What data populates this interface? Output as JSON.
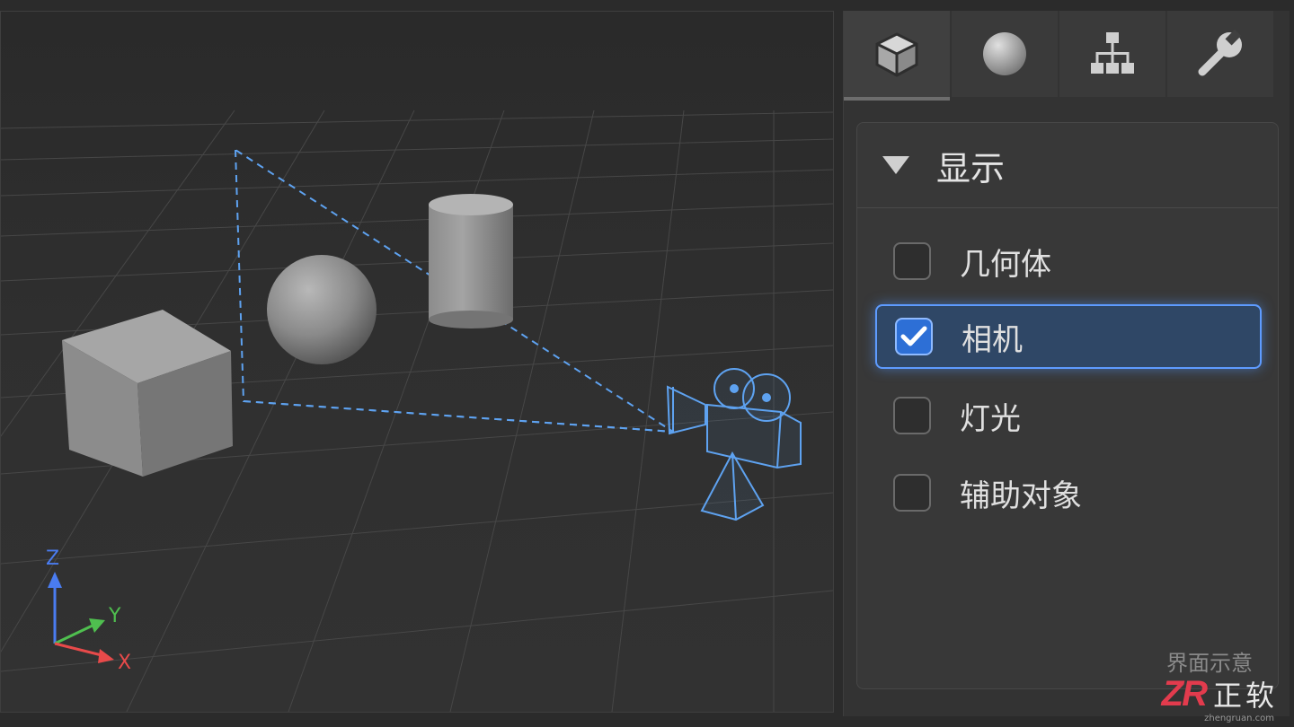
{
  "tabs": [
    {
      "id": "object",
      "icon": "cube-icon"
    },
    {
      "id": "material",
      "icon": "sphere-icon"
    },
    {
      "id": "hierarchy",
      "icon": "hierarchy-icon"
    },
    {
      "id": "tools",
      "icon": "wrench-icon"
    }
  ],
  "active_tab": "object",
  "display_group": {
    "title": "显示",
    "options": [
      {
        "label": "几何体",
        "checked": false
      },
      {
        "label": "相机",
        "checked": true
      },
      {
        "label": "灯光",
        "checked": false
      },
      {
        "label": "辅助对象",
        "checked": false
      }
    ]
  },
  "axes": {
    "z": "Z",
    "y": "Y",
    "x": "X"
  },
  "colors": {
    "accent": "#5e9bff",
    "axis_x": "#e84a4a",
    "axis_y": "#4fbf4f",
    "axis_z": "#4a7cf0"
  },
  "watermark": {
    "caption": "界面示意",
    "logo": "ZR",
    "brand": "正软",
    "url": "zhengruan.com"
  }
}
